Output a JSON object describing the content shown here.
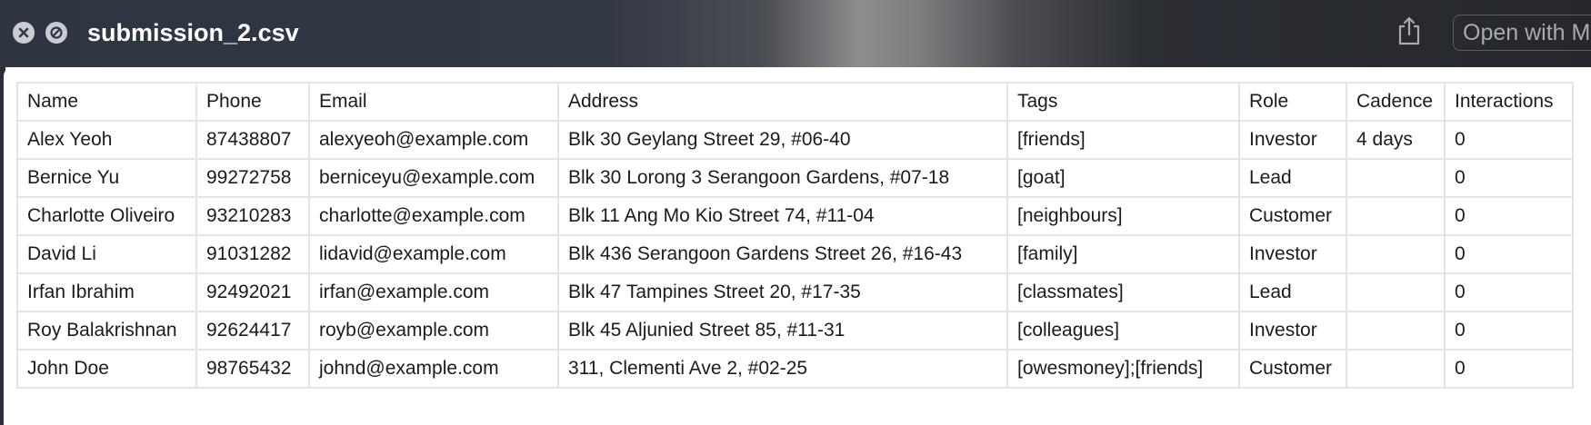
{
  "window": {
    "title": "submission_2.csv",
    "open_with_label": "Open with M"
  },
  "icons": {
    "close": "close-circle-icon",
    "hide": "slash-circle-icon",
    "share": "share-icon"
  },
  "table": {
    "headers": [
      "Name",
      "Phone",
      "Email",
      "Address",
      "Tags",
      "Role",
      "Cadence",
      "Interactions"
    ],
    "rows": [
      [
        "Alex Yeoh",
        "87438807",
        "alexyeoh@example.com",
        "Blk 30 Geylang Street 29, #06-40",
        "[friends]",
        "Investor",
        "4 days",
        "0"
      ],
      [
        "Bernice Yu",
        "99272758",
        "berniceyu@example.com",
        "Blk 30 Lorong 3 Serangoon Gardens, #07-18",
        "[goat]",
        "Lead",
        "",
        "0"
      ],
      [
        "Charlotte Oliveiro",
        "93210283",
        "charlotte@example.com",
        "Blk 11 Ang Mo Kio Street 74, #11-04",
        "[neighbours]",
        "Customer",
        "",
        "0"
      ],
      [
        "David Li",
        "91031282",
        "lidavid@example.com",
        "Blk 436 Serangoon Gardens Street 26, #16-43",
        "[family]",
        "Investor",
        "",
        "0"
      ],
      [
        "Irfan Ibrahim",
        "92492021",
        "irfan@example.com",
        "Blk 47 Tampines Street 20, #17-35",
        "[classmates]",
        "Lead",
        "",
        "0"
      ],
      [
        "Roy Balakrishnan",
        "92624417",
        "royb@example.com",
        "Blk 45 Aljunied Street 85, #11-31",
        "[colleagues]",
        "Investor",
        "",
        "0"
      ],
      [
        "John Doe",
        "98765432",
        "johnd@example.com",
        "311, Clementi Ave 2, #02-25",
        "[owesmoney];[friends]",
        "Customer",
        "",
        "0"
      ]
    ]
  }
}
